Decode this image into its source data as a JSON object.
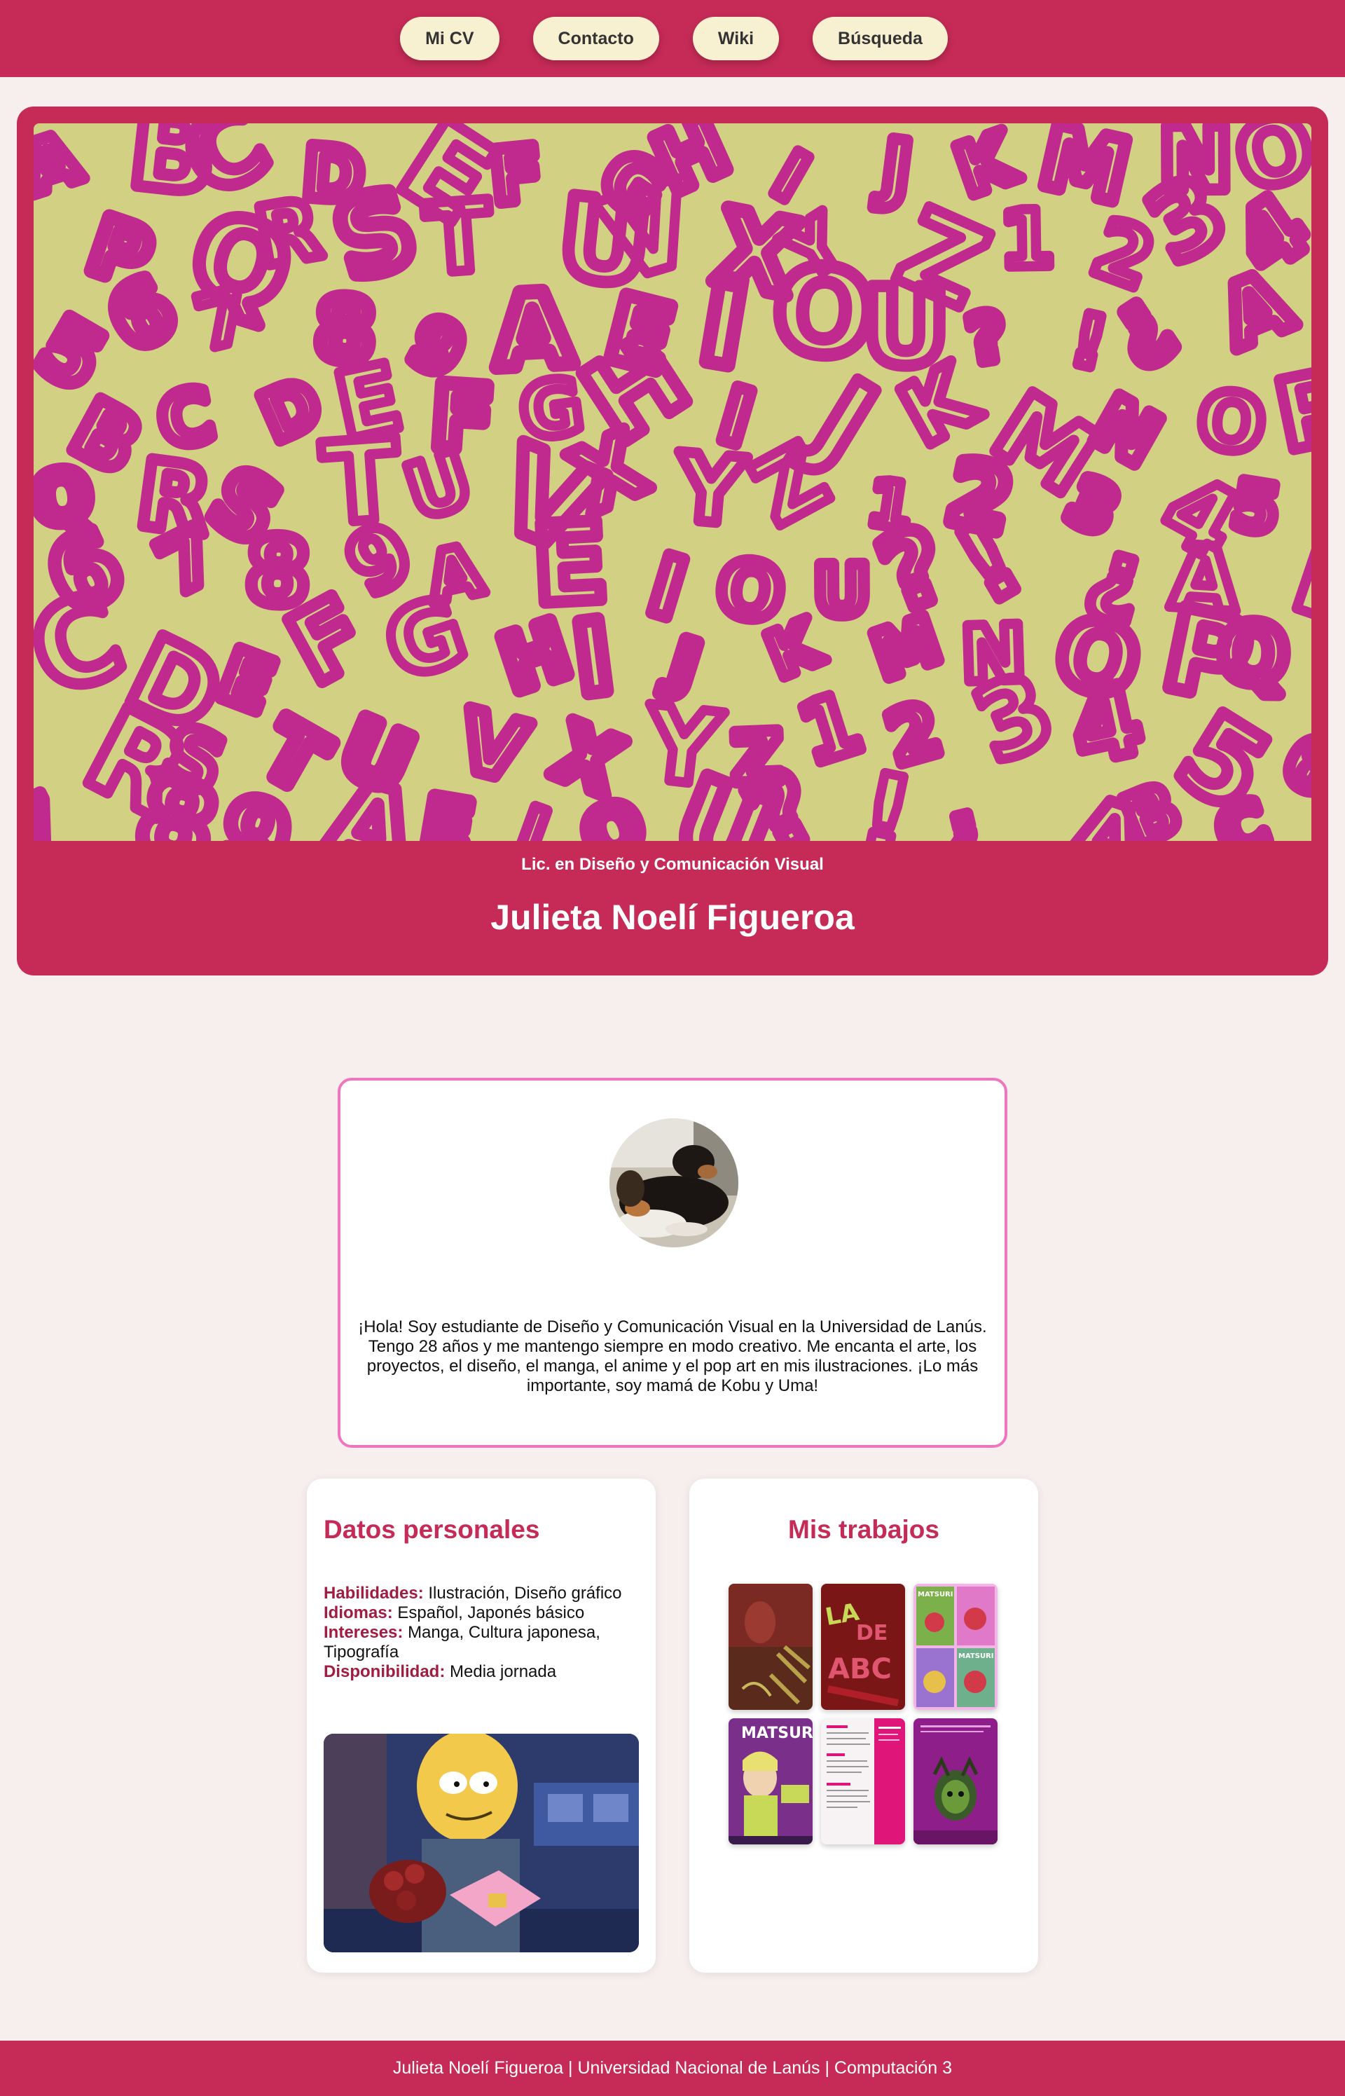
{
  "nav": {
    "items": [
      {
        "label": "Mi CV"
      },
      {
        "label": "Contacto"
      },
      {
        "label": "Wiki"
      },
      {
        "label": "Búsqueda"
      }
    ]
  },
  "hero": {
    "art_glyphs": "ABCDEFGHIJKMNOPQRSTUVXYZ123456789AEIOU?!¿",
    "subtitle": "Lic. en Diseño y Comunicación Visual",
    "title": "Julieta Noelí Figueroa"
  },
  "profile": {
    "bio": "¡Hola! Soy estudiante de Diseño y Comunicación Visual en la Universidad de Lanús. Tengo 28 años y me mantengo siempre en modo creativo. Me encanta el arte, los proyectos, el diseño, el manga, el anime y el pop art en mis ilustraciones. ¡Lo más importante, soy mamá de Kobu y Uma!"
  },
  "datos": {
    "title": "Datos personales",
    "rows": [
      {
        "key": "Habilidades:",
        "value": "Ilustración, Diseño gráfico"
      },
      {
        "key": "Idiomas:",
        "value": "Español, Japonés básico"
      },
      {
        "key": "Intereses:",
        "value": "Manga, Cultura japonesa, Tipografía"
      },
      {
        "key": "Disponibilidad:",
        "value": "Media jornada"
      }
    ]
  },
  "trabajos": {
    "title": "Mis trabajos",
    "thumbs": [
      {
        "text": ""
      },
      {
        "text": "ABC"
      },
      {
        "text": "MATSURI"
      },
      {
        "text": "MATSURI"
      },
      {
        "text": ""
      },
      {
        "text": ""
      }
    ]
  },
  "footer": {
    "text": "Julieta Noelí Figueroa | Universidad Nacional de Lanús | Computación 3"
  },
  "colors": {
    "brand": "#c62b57",
    "nav_button": "#f7f1d2",
    "hero_art_bg": "#d2d183",
    "hero_art_letters": "#c02a8e",
    "profile_border": "#ef75be",
    "background": "#f7eeee"
  }
}
